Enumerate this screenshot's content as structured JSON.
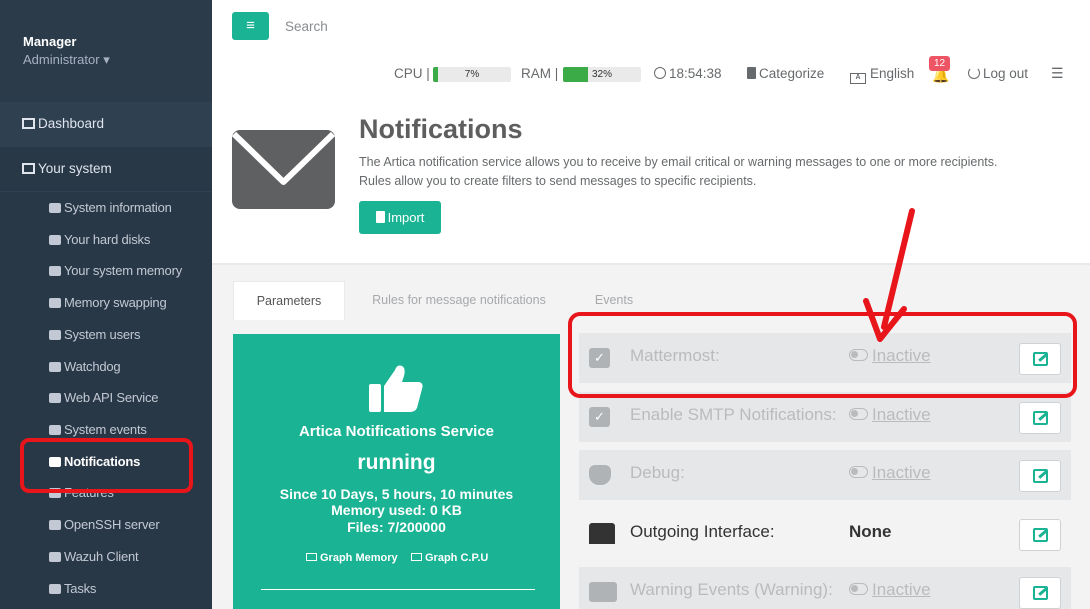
{
  "sidebar": {
    "user_name": "Manager",
    "user_role": "Administrator ▾",
    "top_items": [
      {
        "label": "Dashboard",
        "icon": "dashboard-icon"
      },
      {
        "label": "Your system",
        "icon": "server-icon"
      }
    ],
    "sub_items": [
      {
        "label": "System information",
        "icon": "server-icon"
      },
      {
        "label": "Your hard disks",
        "icon": "hdd-icon"
      },
      {
        "label": "Your system memory",
        "icon": "memory-icon"
      },
      {
        "label": "Memory swapping",
        "icon": "server-icon"
      },
      {
        "label": "System users",
        "icon": "users-icon"
      },
      {
        "label": "Watchdog",
        "icon": "dog-icon"
      },
      {
        "label": "Web API Service",
        "icon": "api-icon"
      },
      {
        "label": "System events",
        "icon": "eye-icon"
      },
      {
        "label": "Notifications",
        "icon": "envelope-icon",
        "active": true
      },
      {
        "label": "Features",
        "icon": "feature-icon"
      },
      {
        "label": "OpenSSH server",
        "icon": "terminal-icon"
      },
      {
        "label": "Wazuh Client",
        "icon": "wazuh-icon"
      },
      {
        "label": "Tasks",
        "icon": "clock-icon"
      }
    ]
  },
  "topbar": {
    "menu_icon": "≡",
    "search_placeholder": "Search",
    "cpu_label": "CPU",
    "cpu_value": "7%",
    "cpu_percent": 7,
    "ram_label": "RAM",
    "ram_value": "32%",
    "ram_percent": 32,
    "time": "18:54:38",
    "categorize": "Categorize",
    "language": "English",
    "notifications_count": "12",
    "logout": "Log out"
  },
  "header": {
    "title": "Notifications",
    "desc_line1": "The Artica notification service allows you to receive by email critical or warning messages to one or more recipients.",
    "desc_line2": "Rules allow you to create filters to send messages to specific recipients.",
    "import_label": "Import"
  },
  "tabs": [
    {
      "label": "Parameters",
      "active": true
    },
    {
      "label": "Rules for message notifications"
    },
    {
      "label": "Events"
    }
  ],
  "service": {
    "title": "Artica Notifications Service",
    "status": "running",
    "since": "Since 10 Days, 5 hours, 10 minutes",
    "memory": "Memory used: 0 KB",
    "files": "Files: 7/200000",
    "graph_memory": "Graph Memory",
    "graph_cpu": "Graph C.P.U"
  },
  "params": [
    {
      "label": "Mattermost:",
      "value": "Inactive",
      "icon": "checkbox-icon"
    },
    {
      "label": "Enable SMTP Notifications:",
      "value": "Inactive",
      "icon": "checkbox-icon"
    },
    {
      "label": "Debug:",
      "value": "Inactive",
      "icon": "bug-icon"
    },
    {
      "label": "Outgoing Interface:",
      "value": "None",
      "icon": "network-icon"
    },
    {
      "label": "Warning Events (Warning):",
      "value": "Inactive",
      "icon": "warning-icon"
    }
  ],
  "colors": {
    "accent": "#1ab394",
    "sidebar": "#2f4050",
    "annotation": "#e8151b"
  }
}
